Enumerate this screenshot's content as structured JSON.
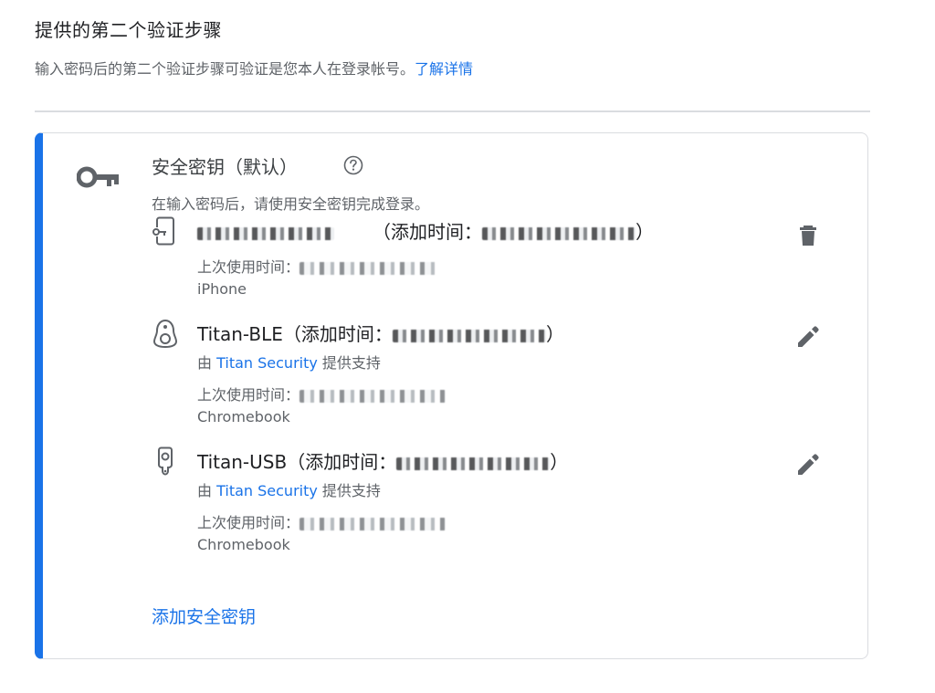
{
  "section": {
    "title": "提供的第二个验证步骤",
    "description": "输入密码后的第二个验证步骤可验证是您本人在登录帐号。",
    "learn_more": "了解详情"
  },
  "card": {
    "title": "安全密钥（默认）",
    "description": "在输入密码后，请使用安全密钥完成登录。",
    "devices": [
      {
        "name": "",
        "added_prefix": "（添加时间：",
        "added_suffix": "）",
        "provider_prefix": "",
        "provider_link": "",
        "provider_suffix": "",
        "last_used_label": "上次使用时间：",
        "platform": "iPhone",
        "icon": "phone-key-icon",
        "action_icon": "delete-icon"
      },
      {
        "name": "Titan-BLE",
        "added_prefix": "（添加时间：",
        "added_suffix": "）",
        "provider_prefix": "由 ",
        "provider_link": "Titan Security",
        "provider_suffix": " 提供支持",
        "last_used_label": "上次使用时间：",
        "platform": "Chromebook",
        "icon": "bluetooth-key-icon",
        "action_icon": "edit-icon"
      },
      {
        "name": "Titan-USB",
        "added_prefix": "（添加时间：",
        "added_suffix": "）",
        "provider_prefix": "由 ",
        "provider_link": "Titan Security",
        "provider_suffix": " 提供支持",
        "last_used_label": "上次使用时间：",
        "platform": "Chromebook",
        "icon": "usb-key-icon",
        "action_icon": "edit-icon"
      }
    ],
    "add_key": "添加安全密钥"
  },
  "colors": {
    "accent": "#1a73e8",
    "text_primary": "#202124",
    "text_secondary": "#5f6368",
    "icon": "#5f6368",
    "border": "#dadce0"
  }
}
